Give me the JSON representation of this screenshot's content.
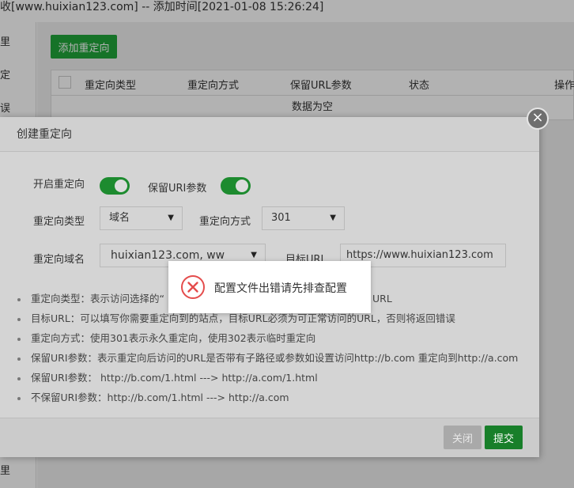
{
  "background": {
    "title": "收[www.huixian123.com] -- 添加时间[2021-01-08 15:26:24]",
    "left_items": [
      "里",
      "定",
      "误",
      "里"
    ],
    "add_button": "添加重定向",
    "table_headers": [
      "重定向类型",
      "重定向方式",
      "保留URL参数",
      "状态",
      "操作"
    ],
    "empty_text": "数据为空"
  },
  "dialog": {
    "title": "创建重定向",
    "close_symbol": "×",
    "labels": {
      "enable_redirect": "开启重定向",
      "keep_uri_params": "保留URI参数",
      "redirect_type": "重定向类型",
      "redirect_method": "重定向方式",
      "redirect_domain": "重定向域名",
      "target_url": "目标URL"
    },
    "toggles": {
      "enable_redirect": true,
      "keep_uri_params": true
    },
    "redirect_type_value": "域名",
    "redirect_method_value": "301",
    "redirect_domain_value": "huixian123.com, ww",
    "target_url_value": "https://www.huixian123.com",
    "tips": [
      "重定向类型：表示访问选择的“",
      "目标URL：可以填写你需要重定向到的站点，目标URL必须为可正常访问的URL，否则将返回错误",
      "重定向方式：使用301表示永久重定向，使用302表示临时重定向",
      "保留URI参数：表示重定向后访问的URL是否带有子路径或参数如设置访问http://b.com 重定向到http://a.com",
      "保留URI参数：  http://b.com/1.html ---> http://a.com/1.html",
      "不保留URI参数：http://b.com/1.html ---> http://a.com"
    ],
    "tip0_tail": "URL",
    "footer": {
      "close_label": "关闭",
      "submit_label": "提交"
    }
  },
  "toast": {
    "message": "配置文件出错请先排查配置",
    "icon": "error-circle-icon",
    "icon_color": "#e44c4c"
  },
  "colors": {
    "accent_green": "#20a53a",
    "toggle_green": "#1d8b2f"
  }
}
